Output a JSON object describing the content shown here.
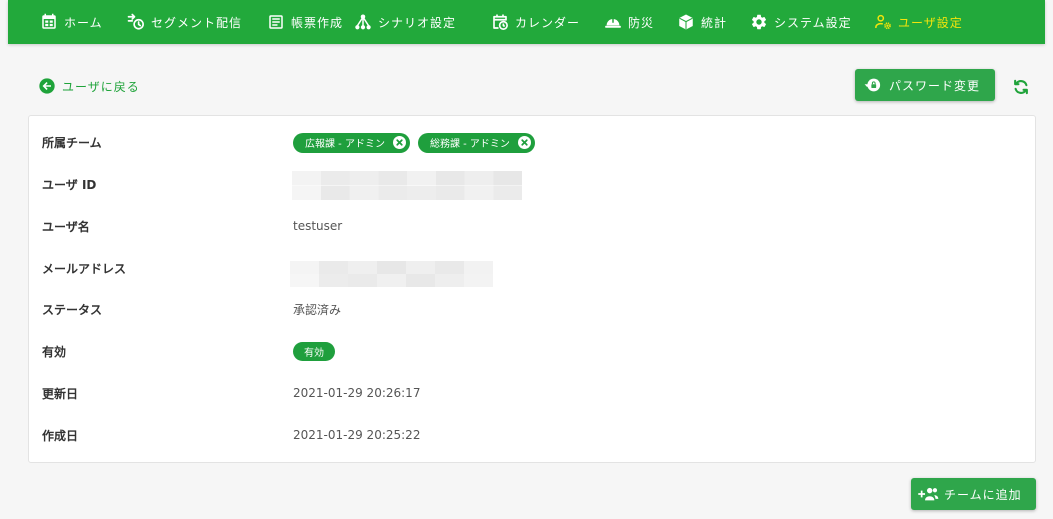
{
  "colors": {
    "primary": "#22a93b",
    "button": "#2fa64b",
    "chip": "#1f9f3d",
    "active": "#f3e40c",
    "link": "#1fa33a"
  },
  "nav": {
    "items": [
      {
        "label": "ホーム",
        "icon": "calendar-list-icon"
      },
      {
        "label": "セグメント配信",
        "icon": "send-clock-icon"
      },
      {
        "label": "帳票作成",
        "icon": "form-icon"
      },
      {
        "label": "シナリオ設定",
        "icon": "sitemap-icon"
      },
      {
        "label": "カレンダー",
        "icon": "calendar-clock-icon"
      },
      {
        "label": "防災",
        "icon": "helmet-icon"
      },
      {
        "label": "統計",
        "icon": "cube-icon"
      },
      {
        "label": "システム設定",
        "icon": "gear-icon"
      },
      {
        "label": "ユーザ設定",
        "icon": "user-cog-icon",
        "active": true
      }
    ]
  },
  "back_link": {
    "label": "ユーザに戻る",
    "icon": "arrow-left-circle-icon"
  },
  "toolbar": {
    "change_password_label": "パスワード変更",
    "change_password_icon": "lock-reset-icon",
    "refresh_icon": "refresh-icon"
  },
  "details": {
    "team": {
      "label": "所属チーム",
      "chips": [
        "広報課 - アドミン",
        "総務課 - アドミン"
      ],
      "chip_remove_icon": "close-circle-icon"
    },
    "user_id": {
      "label": "ユーザ ID"
    },
    "username": {
      "label": "ユーザ名",
      "value": "testuser"
    },
    "email": {
      "label": "メールアドレス"
    },
    "status": {
      "label": "ステータス",
      "value": "承認済み"
    },
    "enabled": {
      "label": "有効",
      "badge": "有効"
    },
    "updated_at": {
      "label": "更新日",
      "value": "2021-01-29 20:26:17"
    },
    "created_at": {
      "label": "作成日",
      "value": "2021-01-29 20:25:22"
    }
  },
  "footer": {
    "add_to_team_label": "チームに追加",
    "add_to_team_icon": "account-multiple-plus-icon"
  }
}
